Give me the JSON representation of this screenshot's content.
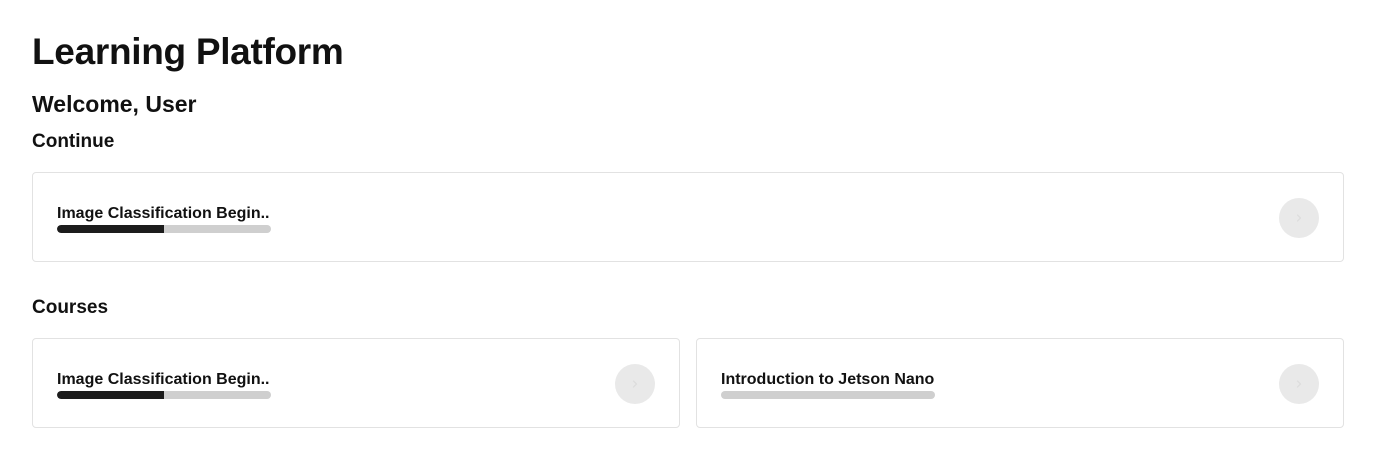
{
  "header": {
    "app_title": "Learning Platform",
    "welcome": "Welcome, User"
  },
  "continue_section": {
    "title": "Continue",
    "course": {
      "title": "Image Classification Begin..",
      "progress": 0.5
    }
  },
  "courses_section": {
    "title": "Courses",
    "items": [
      {
        "title": "Image Classification Begin..",
        "progress": 0.5
      },
      {
        "title": "Introduction to Jetson Nano",
        "progress": 0.0
      }
    ]
  },
  "colors": {
    "progress_fill": "#1c1c1c",
    "progress_track": "#cfcfcf",
    "button_bg": "#e9e9e9",
    "card_border": "#e2e2e2"
  },
  "icons": {
    "go_button": "chevron-right-icon"
  }
}
